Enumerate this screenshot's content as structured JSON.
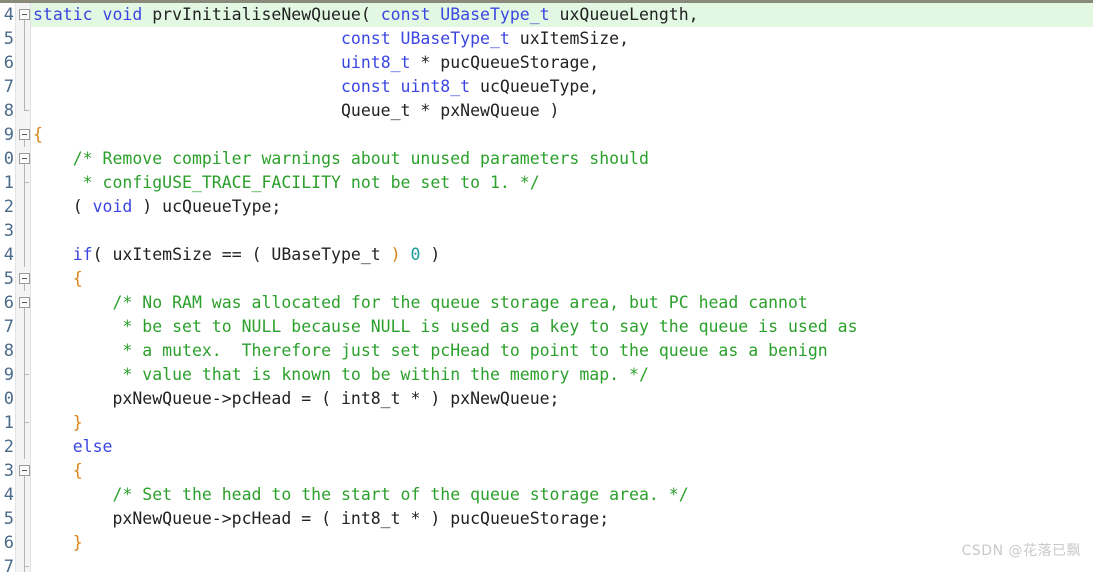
{
  "editor": {
    "name": "code-editor",
    "language": "C",
    "colors": {
      "background": "#ffffff",
      "keyword": "#3b46e0",
      "comment": "#2ca02c",
      "number": "#1a9a9a",
      "bracket": "#d98218",
      "plain": "#222222",
      "current_line_highlight": "#e3f8e3",
      "gutter_background": "#f4f4f4",
      "linenumber": "#4a6a8a"
    }
  },
  "watermark": {
    "text": "CSDN @花落已飘"
  },
  "lines": [
    {
      "num": "4",
      "current": true,
      "fold": "open",
      "tokens": [
        {
          "t": "kw",
          "s": "static void"
        },
        {
          "t": "pl",
          "s": " prvInitialiseNewQueue( "
        },
        {
          "t": "kw",
          "s": "const UBaseType_t"
        },
        {
          "t": "pl",
          "s": " uxQueueLength,"
        }
      ]
    },
    {
      "num": "5",
      "current": false,
      "fold": "line",
      "tokens": [
        {
          "t": "pl",
          "s": "                               "
        },
        {
          "t": "kw",
          "s": "const UBaseType_t"
        },
        {
          "t": "pl",
          "s": " uxItemSize,"
        }
      ]
    },
    {
      "num": "6",
      "current": false,
      "fold": "line",
      "tokens": [
        {
          "t": "pl",
          "s": "                               "
        },
        {
          "t": "kw",
          "s": "uint8_t"
        },
        {
          "t": "pl",
          "s": " * pucQueueStorage,"
        }
      ]
    },
    {
      "num": "7",
      "current": false,
      "fold": "line",
      "tokens": [
        {
          "t": "pl",
          "s": "                               "
        },
        {
          "t": "kw",
          "s": "const uint8_t"
        },
        {
          "t": "pl",
          "s": " ucQueueType,"
        }
      ]
    },
    {
      "num": "8",
      "current": false,
      "fold": "end",
      "tokens": [
        {
          "t": "pl",
          "s": "                               Queue_t * pxNewQueue )"
        }
      ]
    },
    {
      "num": "9",
      "current": false,
      "fold": "open",
      "tokens": [
        {
          "t": "br",
          "s": "{"
        }
      ]
    },
    {
      "num": "0",
      "current": false,
      "fold": "open",
      "tokens": [
        {
          "t": "cmt",
          "s": "    /* Remove compiler warnings about unused parameters should"
        }
      ]
    },
    {
      "num": "1",
      "current": false,
      "fold": "tick",
      "tokens": [
        {
          "t": "cmt",
          "s": "     * configUSE_TRACE_FACILITY not be set to 1. */"
        }
      ]
    },
    {
      "num": "2",
      "current": false,
      "fold": "line",
      "tokens": [
        {
          "t": "pl",
          "s": "    ( "
        },
        {
          "t": "kw",
          "s": "void"
        },
        {
          "t": "pl",
          "s": " ) ucQueueType;"
        }
      ]
    },
    {
      "num": "3",
      "current": false,
      "fold": "line",
      "tokens": []
    },
    {
      "num": "4",
      "current": false,
      "fold": "line",
      "tokens": [
        {
          "t": "pl",
          "s": "    "
        },
        {
          "t": "kw",
          "s": "if"
        },
        {
          "t": "pl",
          "s": "( uxItemSize == ( UBaseType_t "
        },
        {
          "t": "br",
          "s": ")"
        },
        {
          "t": "pl",
          "s": " "
        },
        {
          "t": "num",
          "s": "0"
        },
        {
          "t": "pl",
          "s": " )"
        }
      ]
    },
    {
      "num": "5",
      "current": false,
      "fold": "open",
      "tokens": [
        {
          "t": "pl",
          "s": "    "
        },
        {
          "t": "br",
          "s": "{"
        }
      ]
    },
    {
      "num": "6",
      "current": false,
      "fold": "open",
      "tokens": [
        {
          "t": "cmt",
          "s": "        /* No RAM was allocated for the queue storage area, but PC head cannot"
        }
      ]
    },
    {
      "num": "7",
      "current": false,
      "fold": "line",
      "tokens": [
        {
          "t": "cmt",
          "s": "         * be set to NULL because NULL is used as a key to say the queue is used as"
        }
      ]
    },
    {
      "num": "8",
      "current": false,
      "fold": "line",
      "tokens": [
        {
          "t": "cmt",
          "s": "         * a mutex.  Therefore just set pcHead to point to the queue as a benign"
        }
      ]
    },
    {
      "num": "9",
      "current": false,
      "fold": "tick",
      "tokens": [
        {
          "t": "cmt",
          "s": "         * value that is known to be within the memory map. */"
        }
      ]
    },
    {
      "num": "0",
      "current": false,
      "fold": "line",
      "tokens": [
        {
          "t": "pl",
          "s": "        pxNewQueue->pcHead = ( int8_t * ) pxNewQueue;"
        }
      ]
    },
    {
      "num": "1",
      "current": false,
      "fold": "tick",
      "tokens": [
        {
          "t": "pl",
          "s": "    "
        },
        {
          "t": "br",
          "s": "}"
        }
      ]
    },
    {
      "num": "2",
      "current": false,
      "fold": "line",
      "tokens": [
        {
          "t": "pl",
          "s": "    "
        },
        {
          "t": "kw",
          "s": "else"
        }
      ]
    },
    {
      "num": "3",
      "current": false,
      "fold": "open",
      "tokens": [
        {
          "t": "pl",
          "s": "    "
        },
        {
          "t": "br",
          "s": "{"
        }
      ]
    },
    {
      "num": "4",
      "current": false,
      "fold": "line",
      "tokens": [
        {
          "t": "cmt",
          "s": "        /* Set the head to the start of the queue storage area. */"
        }
      ]
    },
    {
      "num": "5",
      "current": false,
      "fold": "line",
      "tokens": [
        {
          "t": "pl",
          "s": "        pxNewQueue->pcHead = ( int8_t * ) pucQueueStorage;"
        }
      ]
    },
    {
      "num": "6",
      "current": false,
      "fold": "line",
      "tokens": [
        {
          "t": "pl",
          "s": "    "
        },
        {
          "t": "br",
          "s": "}"
        }
      ]
    },
    {
      "num": "7",
      "current": false,
      "fold": "tick",
      "tokens": []
    }
  ]
}
